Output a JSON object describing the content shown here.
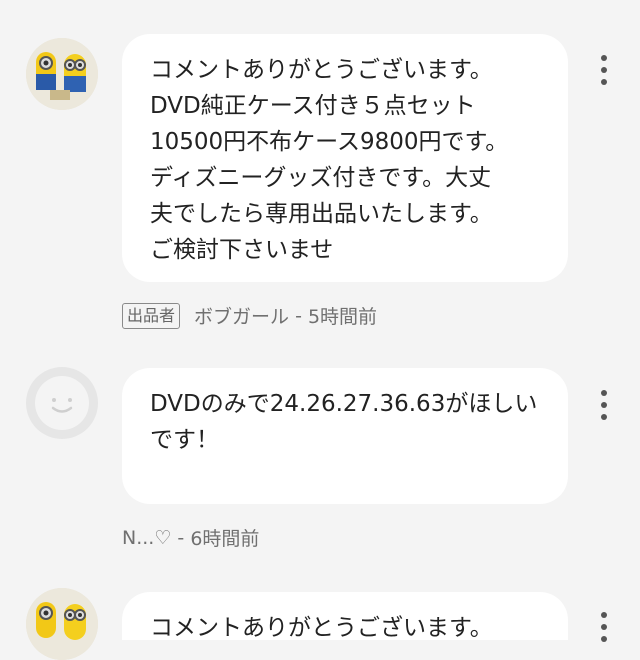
{
  "comments": [
    {
      "avatar": "minion-figures-photo",
      "text": "コメントありがとうございます。\nDVD純正ケース付き５点セット\n10500円不布ケース9800円です。\nディズニーグッズ付きです。大丈\n夫でしたら専用出品いたします。\nご検討下さいませ",
      "badge": "出品者",
      "author": "ボブガール",
      "separator": " - ",
      "time": "5時間前"
    },
    {
      "avatar": "default-smiley-avatar",
      "text": "DVDのみで24.26.27.36.63がほしい\nです！",
      "author": "N...♡",
      "separator": " - ",
      "time": "6時間前"
    },
    {
      "avatar": "minion-figures-photo",
      "text": "コメントありがとうございます。"
    }
  ],
  "colors": {
    "background": "#f4f4f4",
    "bubble": "#ffffff",
    "text": "#222222",
    "meta": "#707070"
  },
  "icons": [
    "more-vertical-icon",
    "default-avatar-face-icon"
  ]
}
